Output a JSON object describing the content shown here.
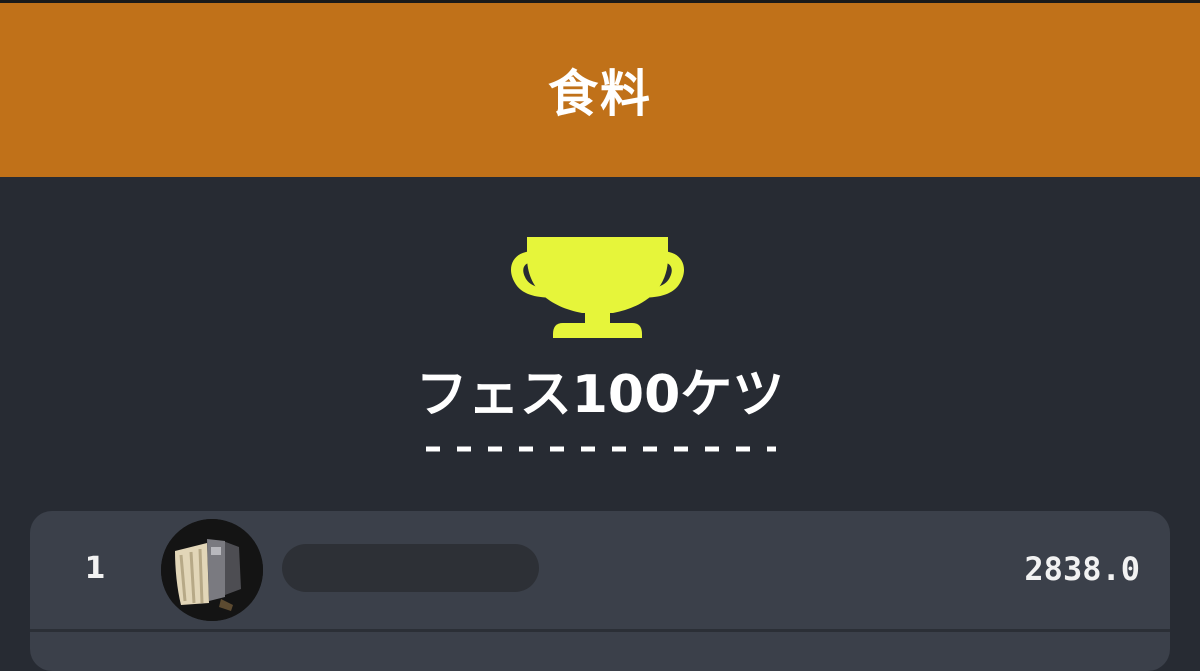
{
  "header": {
    "title": "食料",
    "background": "#c07119"
  },
  "award": {
    "icon": "trophy-icon",
    "icon_color": "#e6f53a",
    "title": "フェス100ケツ"
  },
  "ranking": [
    {
      "rank": "1",
      "avatar_icon": "gear-pack-avatar",
      "name": "",
      "score": "2838.0"
    }
  ]
}
